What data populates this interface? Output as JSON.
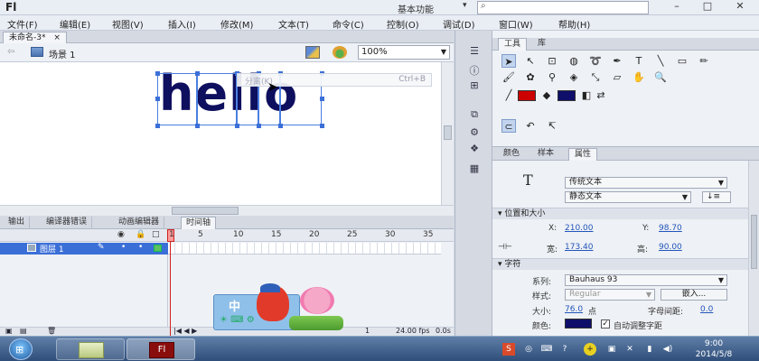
{
  "app": {
    "logo": "Fl",
    "workspace": "基本功能",
    "search_placeholder": ""
  },
  "menu": [
    "文件(F)",
    "编辑(E)",
    "视图(V)",
    "插入(I)",
    "修改(M)",
    "文本(T)",
    "命令(C)",
    "控制(O)",
    "调试(D)",
    "窗口(W)",
    "帮助(H)"
  ],
  "document": {
    "tab": "未命名-3*",
    "tab_close": "×",
    "scene": "场景 1",
    "zoom": "100%"
  },
  "stage": {
    "text": "hello",
    "context_item": "分离(K)",
    "context_shortcut": "Ctrl+B"
  },
  "bottom_tabs": [
    "输出",
    "编译器错误",
    "动画编辑器",
    "时间轴"
  ],
  "timeline": {
    "frame_numbers": [
      "1",
      "5",
      "10",
      "15",
      "20",
      "25",
      "30",
      "35"
    ],
    "layer_name": "图层 1",
    "current_frame": "1",
    "fps": "24.00 fps",
    "time": "0.0s"
  },
  "ime": {
    "label": "中"
  },
  "tools_tabs": [
    "工具",
    "库"
  ],
  "tool_colors": {
    "stroke": "#cc0000",
    "fill": "#0f0f6b"
  },
  "props_tabs": [
    "颜色",
    "样本",
    "属性"
  ],
  "properties": {
    "text_engine": "传统文本",
    "text_type": "静态文本",
    "section_position": "位置和大小",
    "x_label": "X:",
    "x_value": "210.00",
    "y_label": "Y:",
    "y_value": "98.70",
    "w_label": "宽:",
    "w_value": "173.40",
    "h_label": "高:",
    "h_value": "90.00",
    "section_char": "字符",
    "family_label": "系列:",
    "family_value": "Bauhaus 93",
    "style_label": "样式:",
    "style_value": "Regular",
    "embed_button": "嵌入...",
    "size_label": "大小:",
    "size_value": "76.0",
    "size_unit": "点",
    "spacing_label": "字母间距:",
    "spacing_value": "0.0",
    "color_label": "颜色:",
    "color_value": "#0f0f6b",
    "auto_kern_label": "自动调整字距",
    "auto_kern": true
  },
  "clock": {
    "time": "9:00",
    "date": "2014/5/8"
  }
}
